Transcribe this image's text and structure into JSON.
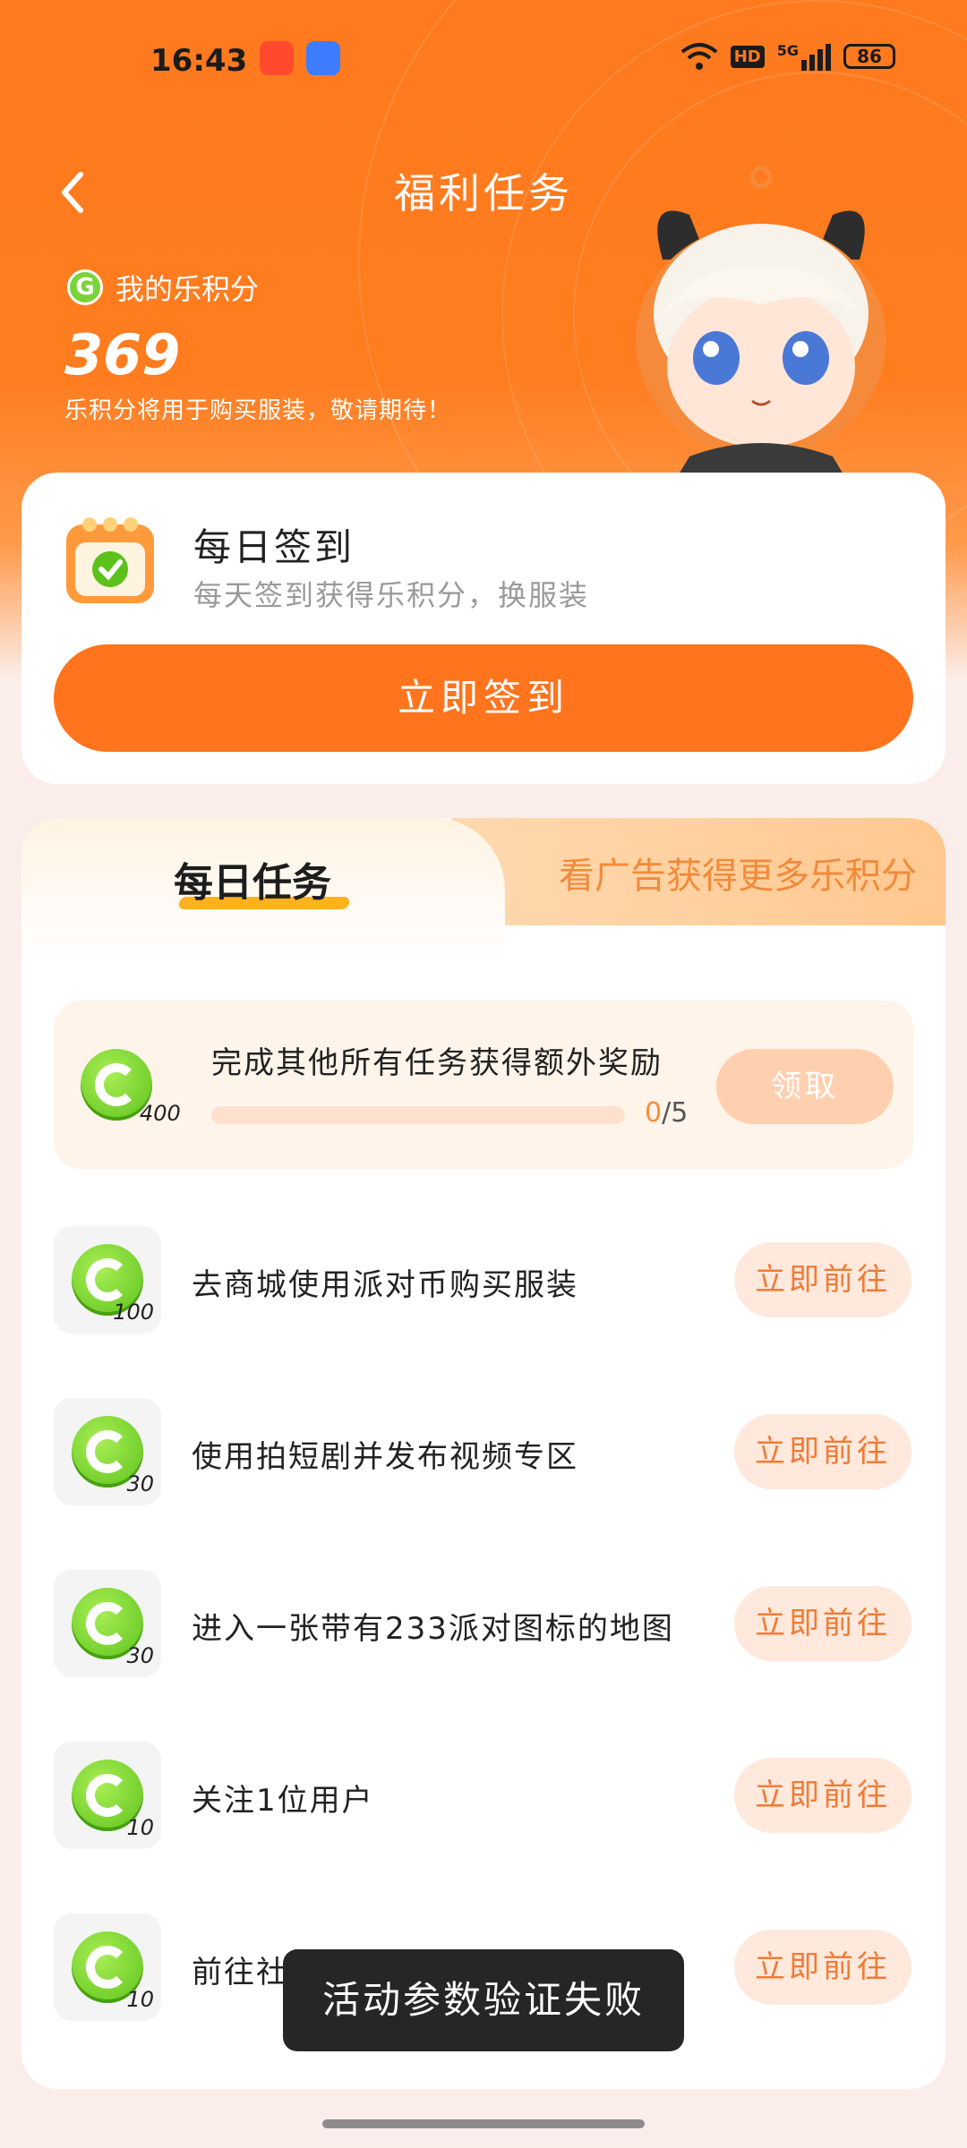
{
  "status_bar": {
    "time": "16:43",
    "hd": "HD",
    "network": "5G",
    "battery": "86"
  },
  "header": {
    "title": "福利任务"
  },
  "points": {
    "label": "我的乐积分",
    "value": "369",
    "note": "乐积分将用于购买服装，敬请期待！"
  },
  "checkin": {
    "title": "每日签到",
    "subtitle": "每天签到获得乐积分，换服装",
    "button": "立即签到"
  },
  "tabs": {
    "daily": "每日任务",
    "ads": "看广告获得更多乐积分"
  },
  "bonus": {
    "title": "完成其他所有任务获得额外奖励",
    "coin_amount": "400",
    "progress_current": "0",
    "progress_total": "/5",
    "progress_fraction": 0,
    "claim_label": "领取"
  },
  "tasks": [
    {
      "label": "去商城使用派对币购买服装",
      "points": "100",
      "button": "立即前往"
    },
    {
      "label": "使用拍短剧并发布视频专区",
      "points": "30",
      "button": "立即前往"
    },
    {
      "label": "进入一张带有233派对图标的地图",
      "points": "30",
      "button": "立即前往"
    },
    {
      "label": "关注1位用户",
      "points": "10",
      "button": "立即前往"
    },
    {
      "label": "前往社区发帖一次帖子",
      "points": "10",
      "button": "立即前往"
    }
  ],
  "toast": {
    "message": "活动参数验证失败"
  },
  "colors": {
    "primary": "#ff741c",
    "coin_green": "#6cce2a",
    "accent_light": "#ffe8dc"
  }
}
